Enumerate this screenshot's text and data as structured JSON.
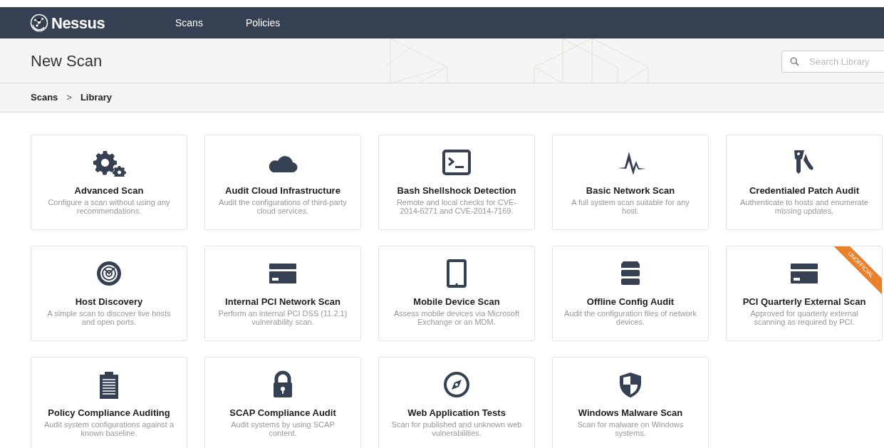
{
  "navbar": {
    "brand": "Nessus",
    "links": [
      {
        "label": "Scans",
        "selected": false
      },
      {
        "label": "Policies",
        "selected": false
      }
    ]
  },
  "header": {
    "title": "New Scan",
    "search": {
      "placeholder": "Search Library"
    }
  },
  "breadcrumb": {
    "items": [
      "Scans",
      "Library"
    ],
    "separator": ">"
  },
  "templates": [
    {
      "kind": "gears",
      "title": "Advanced Scan",
      "description": "Configure a scan without using any recommendations."
    },
    {
      "kind": "cloud",
      "title": "Audit Cloud Infrastructure",
      "description": "Audit the configurations of third-party cloud services."
    },
    {
      "kind": "terminal",
      "title": "Bash Shellshock Detection",
      "description": "Remote and local checks for CVE-2014-6271 and CVE-2014-7169."
    },
    {
      "kind": "pulse",
      "title": "Basic Network Scan",
      "description": "A full system scan suitable for any host."
    },
    {
      "kind": "keys",
      "title": "Credentialed Patch Audit",
      "description": "Authenticate to hosts and enumerate missing updates."
    },
    {
      "kind": "radar",
      "title": "Host Discovery",
      "description": "A simple scan to discover live hosts and open ports."
    },
    {
      "kind": "card",
      "title": "Internal PCI Network Scan",
      "description": "Perform an internal PCI DSS (11.2.1) vulnerability scan."
    },
    {
      "kind": "tablet",
      "title": "Mobile Device Scan",
      "description": "Assess mobile devices via Microsoft Exchange or an MDM."
    },
    {
      "kind": "servers",
      "title": "Offline Config Audit",
      "description": "Audit the configuration files of network devices."
    },
    {
      "kind": "card",
      "title": "PCI Quarterly External Scan",
      "description": "Approved for quarterly external scanning as required by PCI.",
      "ribbon": "UNOFFICIAL"
    },
    {
      "kind": "clipboard",
      "title": "Policy Compliance Auditing",
      "description": "Audit system configurations against a known baseline."
    },
    {
      "kind": "lock",
      "title": "SCAP Compliance Audit",
      "description": "Audit systems by using SCAP content."
    },
    {
      "kind": "compass",
      "title": "Web Application Tests",
      "description": "Scan for published and unknown web vulnerabilities."
    },
    {
      "kind": "shield",
      "title": "Windows Malware Scan",
      "description": "Scan for malware on Windows systems."
    }
  ]
}
